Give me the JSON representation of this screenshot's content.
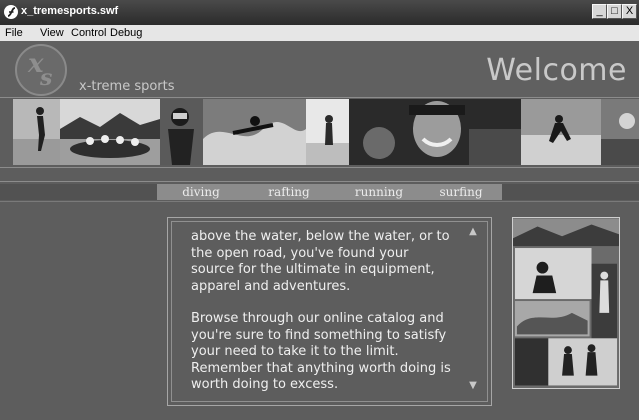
{
  "window": {
    "title": "x_tremesports.swf",
    "controls": {
      "minimize": "_",
      "maximize": "□",
      "close": "X"
    }
  },
  "menu": {
    "items": [
      "File",
      "View",
      "Control",
      "Debug"
    ]
  },
  "header": {
    "brand": "x-treme sports",
    "heading": "Welcome",
    "logo": {
      "x": "x",
      "s": "s"
    }
  },
  "nav": {
    "tabs": [
      "diving",
      "rafting",
      "running",
      "surfing"
    ]
  },
  "content": {
    "paragraphs": [
      "above the water, below the water, or to the open road, you've found your source for the ultimate in equipment, apparel and adventures.",
      "Browse through our online catalog and you're sure to find something to satisfy your need to take it to the limit. Remember that anything worth doing is worth doing to excess."
    ],
    "scroll_up": "▲",
    "scroll_down": "▼"
  },
  "colors": {
    "stage": "#5d5d5d",
    "nav_active": "#8c8c8c",
    "text_light": "#efefef"
  }
}
